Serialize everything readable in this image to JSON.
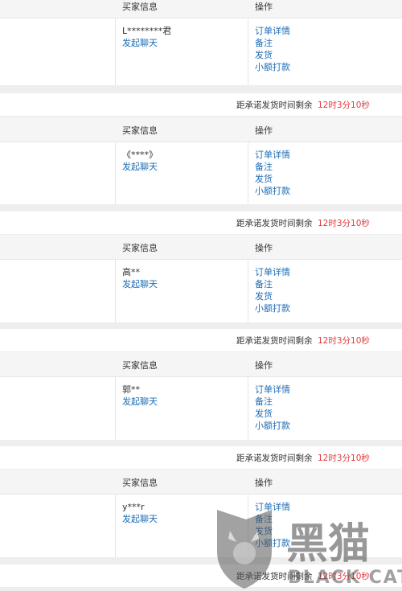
{
  "header_labels": {
    "buyer_info": "买家信息",
    "operation": "操作"
  },
  "countdown": {
    "label": "距承诺发货时间剩余",
    "time": "12时3分10秒"
  },
  "orders": [
    {
      "buyer_name": "L********君",
      "actions": {
        "chat": "发起聊天",
        "detail": "订单详情",
        "note": "备注",
        "ship": "发货",
        "small_pay": "小额打款"
      }
    },
    {
      "buyer_name": "《****》",
      "actions": {
        "chat": "发起聊天",
        "detail": "订单详情",
        "note": "备注",
        "ship": "发货",
        "small_pay": "小额打款"
      }
    },
    {
      "buyer_name": "高**",
      "actions": {
        "chat": "发起聊天",
        "detail": "订单详情",
        "note": "备注",
        "ship": "发货",
        "small_pay": "小额打款"
      }
    },
    {
      "buyer_name": "郭**",
      "actions": {
        "chat": "发起聊天",
        "detail": "订单详情",
        "note": "备注",
        "ship": "发货",
        "small_pay": "小额打款"
      }
    },
    {
      "buyer_name": "y***r",
      "actions": {
        "chat": "发起聊天",
        "detail": "订单详情",
        "note": "备注",
        "ship": "发货",
        "small_pay": "小额打款"
      }
    }
  ],
  "watermark": {
    "brand_cn": "黑猫",
    "brand_en": "BLACK CAT"
  },
  "colors": {
    "link": "#1e6cb5",
    "countdown_time": "#e4393c",
    "header_bg": "#f5f5f5",
    "page_bg": "#eeeeee"
  }
}
